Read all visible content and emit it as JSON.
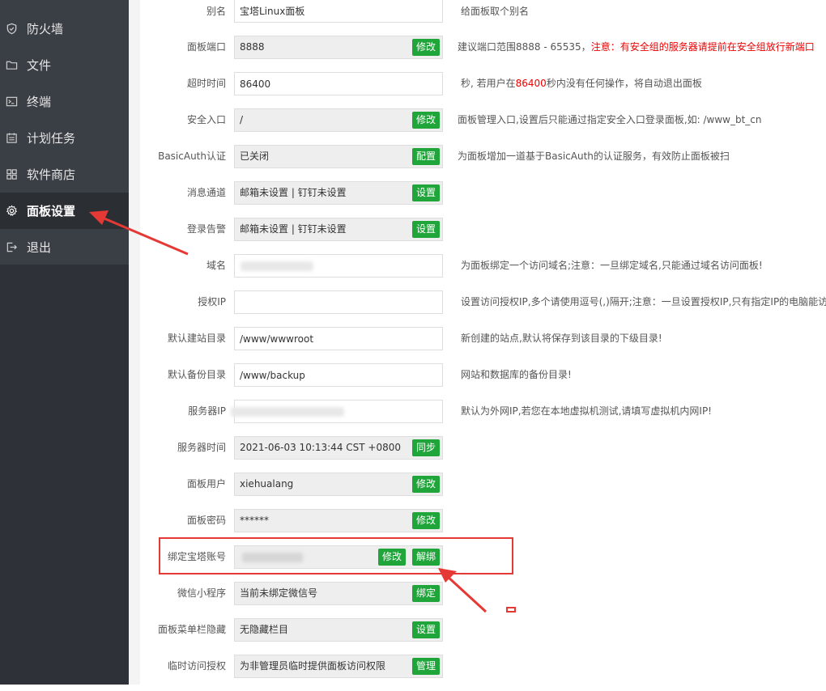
{
  "sidebar": {
    "items": [
      {
        "label": "防火墙",
        "icon": "shield-icon"
      },
      {
        "label": "文件",
        "icon": "folder-icon"
      },
      {
        "label": "终端",
        "icon": "terminal-icon"
      },
      {
        "label": "计划任务",
        "icon": "calendar-icon"
      },
      {
        "label": "软件商店",
        "icon": "grid-icon"
      },
      {
        "label": "面板设置",
        "icon": "gear-icon",
        "active": true
      },
      {
        "label": "退出",
        "icon": "logout-icon"
      }
    ]
  },
  "settings": {
    "alias": {
      "label": "别名",
      "value": "宝塔Linux面板",
      "hint": "给面板取个别名"
    },
    "port": {
      "label": "面板端口",
      "value": "8888",
      "button": "修改",
      "hint": "建议端口范围8888 - 65535，",
      "hint_red": "注意：有安全组的服务器请提前在安全组放行新端口"
    },
    "timeout": {
      "label": "超时时间",
      "value": "86400",
      "hint_a": "秒, 若用户在",
      "hint_red": "86400",
      "hint_b": "秒内没有任何操作，将自动退出面板"
    },
    "entrance": {
      "label": "安全入口",
      "value": "/",
      "button": "修改",
      "hint": "面板管理入口,设置后只能通过指定安全入口登录面板,如: /www_bt_cn"
    },
    "basicauth": {
      "label": "BasicAuth认证",
      "value": "已关闭",
      "button": "配置",
      "hint": "为面板增加一道基于BasicAuth的认证服务，有效防止面板被扫"
    },
    "message": {
      "label": "消息通道",
      "value": "邮箱未设置 | 钉钉未设置",
      "button": "设置"
    },
    "login_alert": {
      "label": "登录告警",
      "value": "邮箱未设置 | 钉钉未设置",
      "button": "设置"
    },
    "domain": {
      "label": "域名",
      "hint": "为面板绑定一个访问域名;注意：一旦绑定域名,只能通过域名访问面板!"
    },
    "auth_ip": {
      "label": "授权IP",
      "value": "",
      "hint": "设置访问授权IP,多个请使用逗号(,)隔开;注意：一旦设置授权IP,只有指定IP的电脑能访"
    },
    "site_dir": {
      "label": "默认建站目录",
      "value": "/www/wwwroot",
      "hint": "新创建的站点,默认将保存到该目录的下级目录!"
    },
    "backup_dir": {
      "label": "默认备份目录",
      "value": "/www/backup",
      "hint": "网站和数据库的备份目录!"
    },
    "server_ip": {
      "label": "服务器IP",
      "hint": "默认为外网IP,若您在本地虚拟机测试,请填写虚拟机内网IP!"
    },
    "server_time": {
      "label": "服务器时间",
      "value": "2021-06-03 10:13:44 CST +0800",
      "button": "同步"
    },
    "panel_user": {
      "label": "面板用户",
      "value": "xiehualang",
      "button": "修改"
    },
    "panel_pass": {
      "label": "面板密码",
      "value": "******",
      "button": "修改"
    },
    "bt_account": {
      "label": "绑定宝塔账号",
      "button_edit": "修改",
      "button_unbind": "解绑"
    },
    "wechat": {
      "label": "微信小程序",
      "value": "当前未绑定微信号",
      "button": "绑定"
    },
    "menu_hide": {
      "label": "面板菜单栏隐藏",
      "value": "无隐藏栏目",
      "button": "设置"
    },
    "temp_access": {
      "label": "临时访问授权",
      "value": "为非管理员临时提供面板访问权限",
      "button": "管理"
    }
  },
  "colors": {
    "accent": "#20a53a",
    "sidebar": "#3a3e45",
    "annotation": "#e53935",
    "warning": "#ee0000"
  }
}
